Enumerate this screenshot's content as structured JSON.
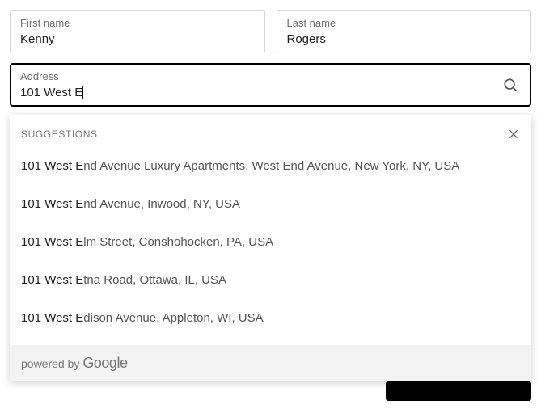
{
  "fields": {
    "first_name": {
      "label": "First name",
      "value": "Kenny"
    },
    "last_name": {
      "label": "Last name",
      "value": "Rogers"
    },
    "address": {
      "label": "Address",
      "value": "101 West E"
    }
  },
  "dropdown": {
    "header": "SUGGESTIONS",
    "match_prefix": "101 West E",
    "items": [
      "101 West End Avenue Luxury Apartments, West End Avenue, New York, NY, USA",
      "101 West End Avenue, Inwood, NY, USA",
      "101 West Elm Street, Conshohocken, PA, USA",
      "101 West Etna Road, Ottawa, IL, USA",
      "101 West Edison Avenue, Appleton, WI, USA"
    ],
    "powered_by_prefix": "powered by",
    "powered_by_brand": "Google"
  }
}
